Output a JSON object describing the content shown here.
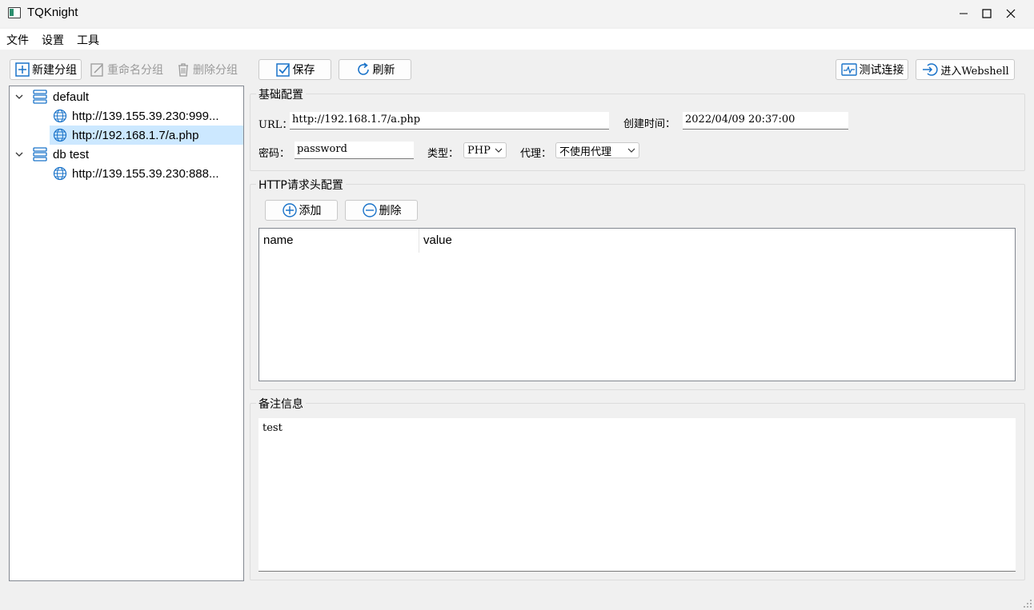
{
  "window": {
    "title": "TQKnight"
  },
  "menu": [
    "文件",
    "设置",
    "工具"
  ],
  "left_toolbar": {
    "new_group": "新建分组",
    "rename_group": "重命名分组",
    "delete_group": "删除分组"
  },
  "tree": {
    "groups": [
      {
        "label": "default",
        "items": [
          "http://139.155.39.230:999...",
          "http://192.168.1.7/a.php"
        ]
      },
      {
        "label": "db test",
        "items": [
          "http://139.155.39.230:888..."
        ]
      }
    ]
  },
  "toolbar": {
    "save": "保存",
    "refresh": "刷新",
    "test_connection": "测试连接",
    "enter_webshell": "进入Webshell"
  },
  "basic_config": {
    "title": "基础配置",
    "url_label": "URL：",
    "url_value": "http://192.168.1.7/a.php",
    "created_label": "创建时间：",
    "created_value": "2022/04/09 20:37:00",
    "password_label": "密码：",
    "password_value": "password",
    "type_label": "类型：",
    "type_value": "PHP",
    "proxy_label": "代理：",
    "proxy_value": "不使用代理"
  },
  "http_headers": {
    "title": "HTTP请求头配置",
    "add": "添加",
    "delete": "删除",
    "columns": [
      "name",
      "value"
    ]
  },
  "notes": {
    "title": "备注信息",
    "value": "test"
  },
  "colors": {
    "selected_row": "#cce8ff",
    "icon_blue": "#1a73c9",
    "accent_green": "#2d8f6f"
  }
}
